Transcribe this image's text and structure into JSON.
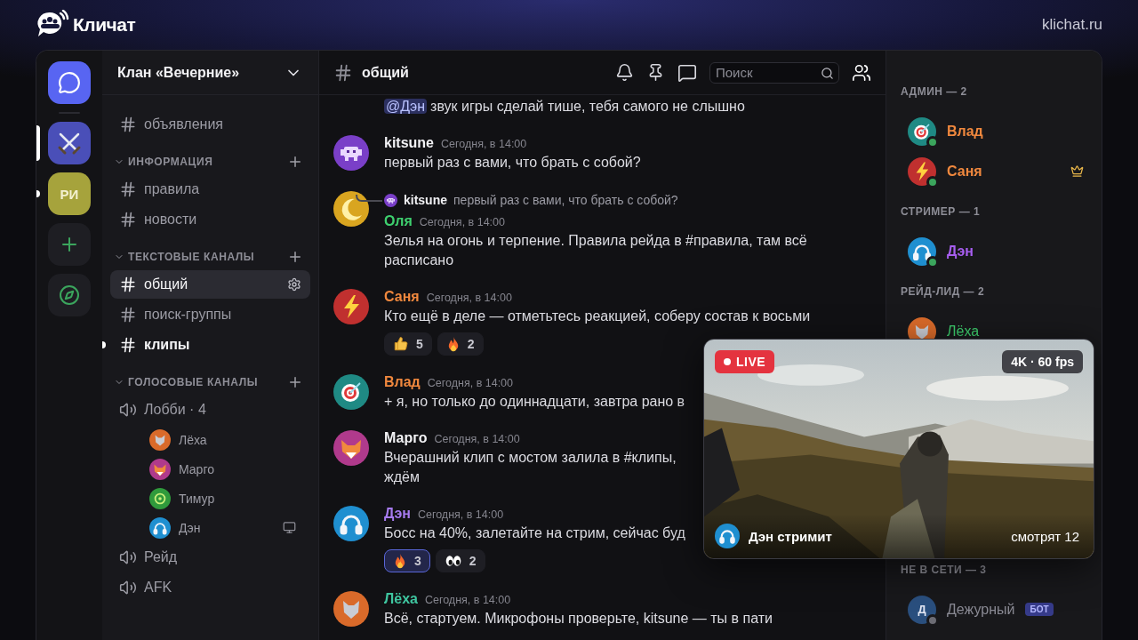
{
  "brand": {
    "name": "Кличат",
    "domain": "klichat.ru"
  },
  "servers": [
    {
      "kind": "home",
      "selected": false,
      "unread": false
    },
    {
      "kind": "emblem",
      "selected": true,
      "unread": false,
      "color": "#4a4fb8"
    },
    {
      "kind": "initials",
      "label": "РИ",
      "selected": false,
      "unread": true,
      "color": "#a6a33c"
    },
    {
      "kind": "add",
      "selected": false,
      "unread": false
    },
    {
      "kind": "explore",
      "selected": false,
      "unread": false
    }
  ],
  "sidebar": {
    "server_name": "Клан «Вечерние»",
    "groups": [
      {
        "channels": [
          {
            "kind": "text",
            "name": "объявления",
            "selected": false,
            "unread": false
          }
        ]
      },
      {
        "category": "ИНФОРМАЦИЯ",
        "expanded": true,
        "channels": [
          {
            "kind": "text",
            "name": "правила",
            "selected": false,
            "unread": false
          },
          {
            "kind": "text",
            "name": "новости",
            "selected": false,
            "unread": false
          }
        ]
      },
      {
        "category": "ТЕКСТОВЫЕ КАНАЛЫ",
        "expanded": true,
        "channels": [
          {
            "kind": "text",
            "name": "общий",
            "selected": true,
            "unread": false
          },
          {
            "kind": "text",
            "name": "поиск-группы",
            "selected": false,
            "unread": false
          },
          {
            "kind": "text",
            "name": "клипы",
            "selected": false,
            "unread": true
          }
        ]
      },
      {
        "category": "ГОЛОСОВЫЕ КАНАЛЫ",
        "expanded": true,
        "channels": [
          {
            "kind": "voice",
            "name": "Лобби · 4",
            "selected": false,
            "unread": false,
            "children": [
              {
                "name": "Лёха",
                "avatar": {
                  "kind": "wolf",
                  "color": "#d96a2a"
                },
                "streaming": false
              },
              {
                "name": "Марго",
                "avatar": {
                  "kind": "fox",
                  "color": "#b03a8c"
                },
                "streaming": false
              },
              {
                "name": "Тимур",
                "avatar": {
                  "kind": "dragon",
                  "color": "#2f9a3c"
                },
                "streaming": false
              },
              {
                "name": "Дэн",
                "avatar": {
                  "kind": "headphones",
                  "color": "#1f8fd0"
                },
                "streaming": true
              }
            ]
          },
          {
            "kind": "voice",
            "name": "Рейд",
            "selected": false,
            "unread": false
          },
          {
            "kind": "voice",
            "name": "AFK",
            "selected": false,
            "unread": false
          }
        ]
      }
    ]
  },
  "chat": {
    "channel": "общий",
    "search": {
      "placeholder": "Поиск"
    },
    "messages": [
      {
        "kind": "continuation",
        "mention": "@Дэн",
        "lines": [
          "звук игры сделай тише, тебя самого не слышно"
        ]
      },
      {
        "kind": "message",
        "author": "kitsune",
        "color": "#f2f2f5",
        "avatar": {
          "kind": "alien",
          "color": "#7a3fc8"
        },
        "time": "Сегодня, в 14:00",
        "lines": [
          "первый раз с вами, что брать с собой?"
        ]
      },
      {
        "kind": "reply",
        "reply": {
          "author": "kitsune",
          "text": "первый раз с вами, что брать с собой?",
          "avatar": {
            "kind": "alien",
            "color": "#7a3fc8"
          }
        },
        "author": "Оля",
        "color": "#3ecf6e",
        "avatar": {
          "kind": "moon",
          "color": "#d9a520"
        },
        "time": "Сегодня, в 14:00",
        "lines": [
          "Зелья на огонь и терпение. Правила рейда в #правила, там всё",
          "расписано"
        ]
      },
      {
        "kind": "message",
        "author": "Саня",
        "color": "#f0883e",
        "avatar": {
          "kind": "bolt",
          "color": "#c0302f"
        },
        "time": "Сегодня, в 14:00",
        "lines": [
          "Кто ещё в деле — отметьтесь реакцией, соберу состав к восьми"
        ],
        "reactions": [
          {
            "kind": "thumbs",
            "count": "5",
            "selected": false
          },
          {
            "kind": "fire",
            "count": "2",
            "selected": false
          }
        ]
      },
      {
        "kind": "message",
        "author": "Влад",
        "color": "#f0883e",
        "avatar": {
          "kind": "target",
          "color": "#1f8a84"
        },
        "time": "Сегодня, в 14:00",
        "lines": [
          "+ я, но только до одиннадцати, завтра рано в"
        ]
      },
      {
        "kind": "message",
        "author": "Марго",
        "color": "#f2f2f5",
        "avatar": {
          "kind": "fox",
          "color": "#b03a8c"
        },
        "time": "Сегодня, в 14:00",
        "lines": [
          "Вчерашний клип с мостом залила в #клипы,",
          "ждём"
        ]
      },
      {
        "kind": "message",
        "author": "Дэн",
        "color": "#a77bf0",
        "avatar": {
          "kind": "headphones",
          "color": "#1f8fd0"
        },
        "time": "Сегодня, в 14:00",
        "lines": [
          "Босс на 40%, залетайте на стрим, сейчас буд"
        ],
        "reactions": [
          {
            "kind": "fire",
            "count": "3",
            "selected": true
          },
          {
            "kind": "eyes",
            "count": "2",
            "selected": false
          }
        ]
      },
      {
        "kind": "message",
        "author": "Лёха",
        "color": "#3fc6a0",
        "avatar": {
          "kind": "wolf",
          "color": "#d96a2a"
        },
        "time": "Сегодня, в 14:00",
        "lines": [
          "Всё, стартуем. Микрофоны проверьте, kitsune — ты в пати"
        ]
      }
    ]
  },
  "members": {
    "groups": [
      {
        "kind": "online",
        "title": "АДМИН — 2",
        "members": [
          {
            "name": "Влад",
            "color": "#f0883e",
            "avatar": {
              "kind": "target",
              "color": "#1f8a84"
            },
            "online": true,
            "owner": false
          },
          {
            "name": "Саня",
            "color": "#f0883e",
            "avatar": {
              "kind": "bolt",
              "color": "#c0302f"
            },
            "online": true,
            "owner": true
          }
        ]
      },
      {
        "kind": "online",
        "title": "СТРИМЕР — 1",
        "members": [
          {
            "name": "Дэн",
            "color": "#a75ef0",
            "avatar": {
              "kind": "headphones",
              "color": "#1f8fd0"
            },
            "online": true,
            "owner": false
          }
        ]
      },
      {
        "kind": "online",
        "title": "РЕЙД-ЛИД — 2",
        "members": [
          {
            "name": "Лёха",
            "color": "#3ecf6e",
            "avatar": {
              "kind": "wolf",
              "color": "#d96a2a"
            },
            "owner": false
          }
        ]
      },
      {
        "kind": "offline",
        "title": "НЕ В СЕТИ — 3",
        "members": [
          {
            "name": "Дежурный",
            "tag": "БОТ",
            "color": "#8a8a94",
            "avatar": {
              "kind": "initial",
              "initial": "Д",
              "color": "#2a4f7e"
            },
            "online": false,
            "owner": false
          }
        ]
      }
    ]
  },
  "stream": {
    "live_label": "LIVE",
    "quality": "4K · 60 fps",
    "streamer": "Дэн стримит",
    "viewers": "смотрят 12",
    "avatar": {
      "kind": "headphones",
      "color": "#1f8fd0"
    }
  }
}
